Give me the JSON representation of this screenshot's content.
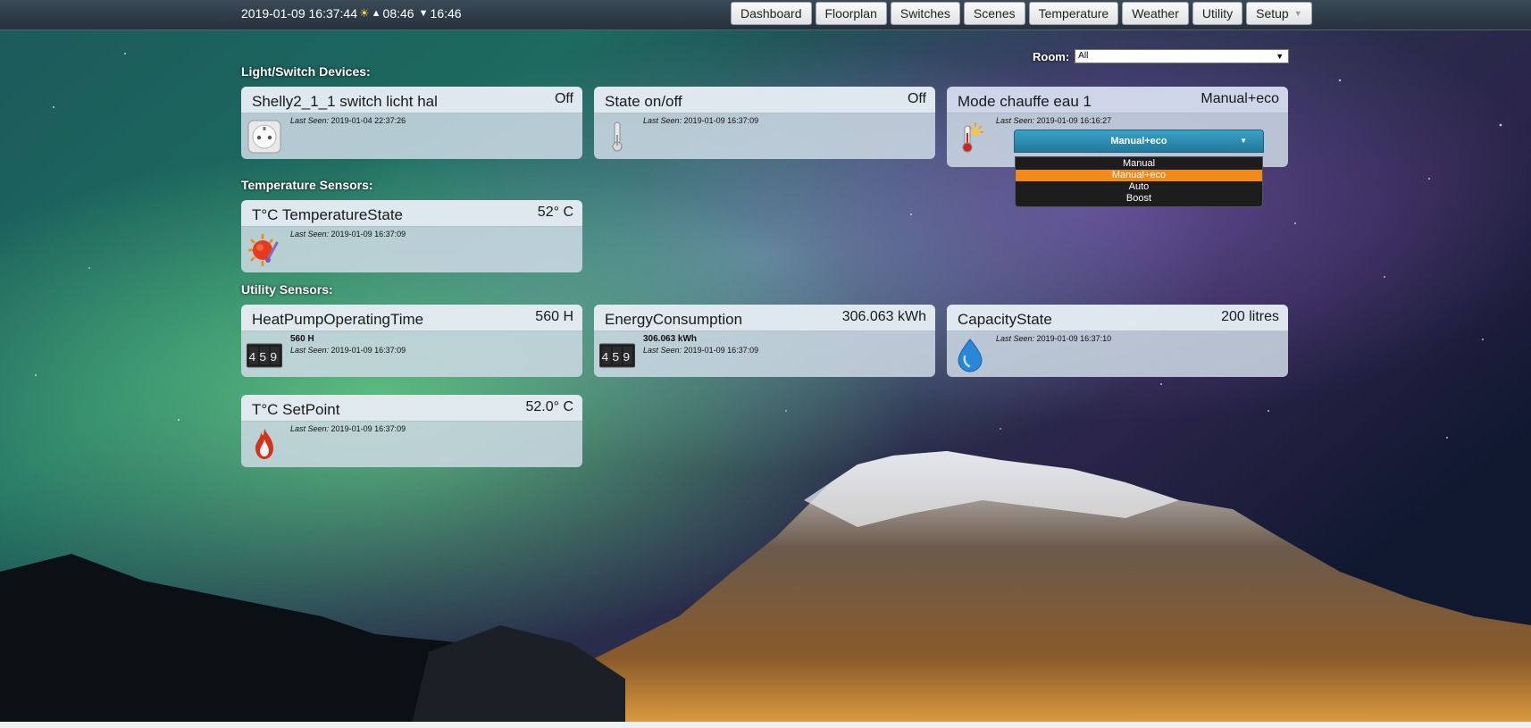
{
  "header": {
    "datetime": "2019-01-09 16:37:44",
    "sunrise": "08:46",
    "sunset": "16:46",
    "nav": [
      {
        "label": "Dashboard"
      },
      {
        "label": "Floorplan"
      },
      {
        "label": "Switches"
      },
      {
        "label": "Scenes"
      },
      {
        "label": "Temperature"
      },
      {
        "label": "Weather"
      },
      {
        "label": "Utility"
      },
      {
        "label": "Setup"
      }
    ]
  },
  "room": {
    "label": "Room:",
    "value": "All"
  },
  "sections": {
    "light": "Light/Switch Devices:",
    "temperature": "Temperature Sensors:",
    "utility": "Utility Sensors:"
  },
  "devices": {
    "shelly": {
      "name": "Shelly2_1_1 switch licht hal",
      "value": "Off",
      "last_seen_label": "Last Seen:",
      "last_seen": "2019-01-04 22:37:26",
      "icon": "power-socket-icon"
    },
    "state": {
      "name": "State on/off",
      "value": "Off",
      "last_seen_label": "Last Seen:",
      "last_seen": "2019-01-09 16:37:09",
      "icon": "thermometer-icon"
    },
    "mode": {
      "name": "Mode chauffe eau 1",
      "value": "Manual+eco",
      "last_seen_label": "Last Seen:",
      "last_seen": "2019-01-09 16:16:27",
      "icon": "hot-thermometer-icon",
      "selected": "Manual+eco",
      "options": [
        "Manual",
        "Manual+eco",
        "Auto",
        "Boost"
      ]
    },
    "temp_state": {
      "name": "T°C TemperatureState",
      "value": "52° C",
      "last_seen_label": "Last Seen:",
      "last_seen": "2019-01-09 16:37:09",
      "icon": "sun-temperature-icon"
    },
    "heatpump": {
      "name": "HeatPumpOperatingTime",
      "value": "560 H",
      "counter": "560 H",
      "last_seen_label": "Last Seen:",
      "last_seen": "2019-01-09 16:37:09",
      "icon": "counter-icon"
    },
    "energy": {
      "name": "EnergyConsumption",
      "value": "306.063 kWh",
      "counter": "306.063 kWh",
      "last_seen_label": "Last Seen:",
      "last_seen": "2019-01-09 16:37:09",
      "icon": "counter-icon"
    },
    "capacity": {
      "name": "CapacityState",
      "value": "200 litres",
      "last_seen_label": "Last Seen:",
      "last_seen": "2019-01-09 16:37:10",
      "icon": "water-drop-icon"
    },
    "setpoint": {
      "name": "T°C SetPoint",
      "value": "52.0° C",
      "last_seen_label": "Last Seen:",
      "last_seen": "2019-01-09 16:37:09",
      "icon": "flame-icon"
    }
  },
  "counter_digits": "459",
  "colors": {
    "accent": "#2b8db3",
    "selected_option": "#f28a1a"
  }
}
